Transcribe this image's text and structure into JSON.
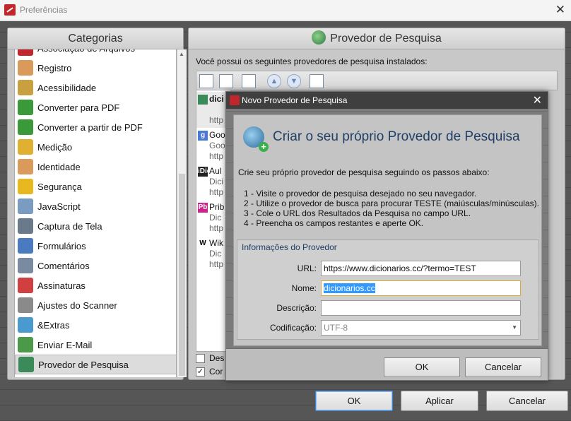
{
  "window": {
    "title": "Preferências",
    "close_glyph": "✕"
  },
  "categories": {
    "header": "Categorias",
    "items": [
      {
        "label": "Associação de Arquivos",
        "icon": "file-association-icon",
        "color": "#c0262c"
      },
      {
        "label": "Registro",
        "icon": "user-icon",
        "color": "#d99a5b"
      },
      {
        "label": "Acessibilidade",
        "icon": "glasses-icon",
        "color": "#c8a040"
      },
      {
        "label": "Converter para PDF",
        "icon": "convert-to-pdf-icon",
        "color": "#3a9a3a"
      },
      {
        "label": "Converter a partir de PDF",
        "icon": "convert-from-pdf-icon",
        "color": "#3a9a3a"
      },
      {
        "label": "Medição",
        "icon": "ruler-icon",
        "color": "#e0b030"
      },
      {
        "label": "Identidade",
        "icon": "identity-icon",
        "color": "#d99a5b"
      },
      {
        "label": "Segurança",
        "icon": "shield-icon",
        "color": "#e8b820"
      },
      {
        "label": "JavaScript",
        "icon": "javascript-icon",
        "color": "#7a9cc0"
      },
      {
        "label": "Captura de Tela",
        "icon": "camera-icon",
        "color": "#6a7a8a"
      },
      {
        "label": "Formulários",
        "icon": "forms-icon",
        "color": "#4a7ac0"
      },
      {
        "label": "Comentários",
        "icon": "comments-icon",
        "color": "#7a8aa0"
      },
      {
        "label": "Assinaturas",
        "icon": "signature-icon",
        "color": "#d04040"
      },
      {
        "label": "Ajustes do Scanner",
        "icon": "scanner-icon",
        "color": "#8a8a8a"
      },
      {
        "label": "&Extras",
        "icon": "extras-icon",
        "color": "#4a9ad0"
      },
      {
        "label": "Enviar E-Mail",
        "icon": "email-icon",
        "color": "#4a9a4a"
      },
      {
        "label": "Provedor de Pesquisa",
        "icon": "search-provider-icon",
        "color": "#3a8a5a"
      }
    ]
  },
  "provider_panel": {
    "header": "Provedor de Pesquisa",
    "intro": "Você possui os seguintes provedores de pesquisa instalados:",
    "providers": [
      {
        "name": "dici",
        "desc": "",
        "url": "http",
        "icon_text": "",
        "icon_color": "#3a8a5a"
      },
      {
        "name": "Goo",
        "desc": "Goo",
        "url": "http",
        "icon_text": "g",
        "icon_color": "#4a7ad8"
      },
      {
        "name": "Aul",
        "desc": "Dici",
        "url": "http",
        "icon_text": "iDic",
        "icon_color": "#222222"
      },
      {
        "name": "Prib",
        "desc": "Dic",
        "url": "http",
        "icon_text": "Pb",
        "icon_color": "#d0208a"
      },
      {
        "name": "Wik",
        "desc": "Dic",
        "url": "http",
        "icon_text": "W",
        "icon_color": "#ffffff"
      }
    ],
    "check1": "Des",
    "check2": "Cor",
    "check2_mark": "✓"
  },
  "buttons": {
    "ok": "OK",
    "apply": "Aplicar",
    "cancel": "Cancelar"
  },
  "dialog": {
    "title": "Novo Provedor de Pesquisa",
    "close_glyph": "✕",
    "heading": "Criar o seu próprio Provedor de Pesquisa",
    "description": "Crie seu próprio provedor de pesquisa seguindo os passos abaixo:",
    "steps": [
      "1 - Visite o provedor de pesquisa desejado no seu navegador.",
      "2 - Utilize o provedor de busca para procurar TESTE (maiúsculas/minúsculas).",
      "3 - Cole o URL dos Resultados da Pesquisa no campo URL.",
      "4 - Preencha os campos restantes e aperte OK."
    ],
    "info_legend": "Informações do Provedor",
    "fields": {
      "url_label": "URL:",
      "url_value": "https://www.dicionarios.cc/?termo=TEST",
      "name_label": "Nome:",
      "name_value": "dicionarios.cc",
      "desc_label": "Descrição:",
      "desc_value": "",
      "enc_label": "Codificação:",
      "enc_value": "UTF-8"
    },
    "ok": "OK",
    "cancel": "Cancelar"
  }
}
